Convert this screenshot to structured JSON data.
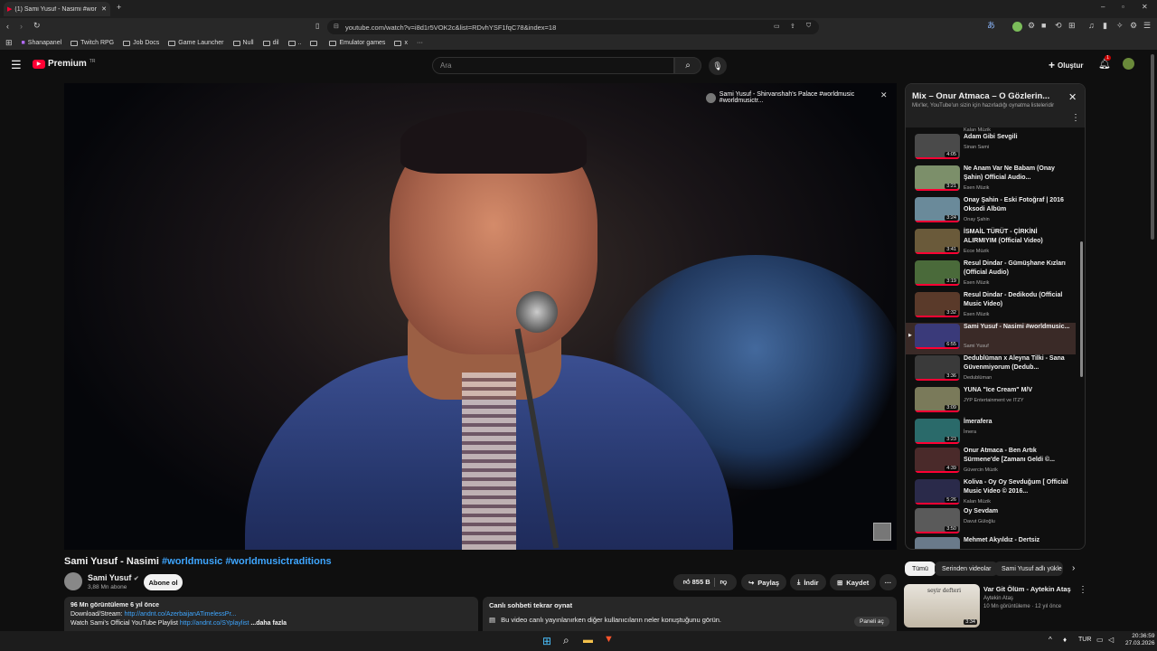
{
  "browser": {
    "tab_title": "(1) Sami Yusuf - Nasimi #wor",
    "url": "youtube.com/watch?v=i8d1r5VOK2c&list=RDvhYSF1fqC78&index=18",
    "bookmarks": [
      "Shanapanel",
      "Twitch RPG",
      "Job Docs",
      "Game Launcher",
      "Null",
      "dil",
      "..",
      "",
      "Emulator games",
      "x"
    ]
  },
  "header": {
    "logo": "Premium",
    "logo_sup": "TR",
    "search_placeholder": "Ara",
    "create_label": "Oluştur",
    "notif_count": "1"
  },
  "video": {
    "overlay_title": "Sami Yusuf - Shirvanshah's Palace #worldmusic #worldmusictr...",
    "title_main": "Sami Yusuf - Nasimi ",
    "title_tags": "#worldmusic #worldmusictraditions"
  },
  "channel": {
    "name": "Sami Yusuf",
    "subs": "3,88 Mn abone",
    "subscribe": "Abone ol"
  },
  "actions": {
    "likes": "855 B",
    "share": "Paylaş",
    "download": "İndir",
    "save": "Kaydet"
  },
  "description": {
    "line1": "96 Mn görüntüleme  6 yıl önce",
    "line2_prefix": "Download/Stream: ",
    "line2_link": "http://andnt.co/AzerbaijanATimelessPr...",
    "line3_prefix": "Watch Sami's Official YouTube Playlist ",
    "line3_link": "http://andnt.co/SYplaylist",
    "more": " ...daha fazla"
  },
  "chat": {
    "title": "Canlı sohbeti tekrar oynat",
    "text": "Bu video canlı yayınlanırken diğer kullanıcıların neler konuştuğunu görün.",
    "button": "Paneli aç"
  },
  "playlist": {
    "title": "Mix – Onur Atmaca – O Gözlerin...",
    "subtitle": "Mix'ler, YouTube'un sizin için hazırladığı oynatma listeleridir",
    "top_channel": "Kalan Müzik",
    "items": [
      {
        "title": "Adam Gibi Sevgili",
        "channel": "Sinan Sami",
        "dur": "4:05",
        "color": "#4a4a4a"
      },
      {
        "title": "Ne Anam Var Ne Babam (Onay Şahin) Official Audio...",
        "channel": "Esen Müzik",
        "dur": "3:21",
        "color": "#7c8f6a"
      },
      {
        "title": "Onay Şahin - Eski Fotoğraf | 2016 Oksodi Albüm",
        "channel": "Onay Şahin",
        "dur": "3:24",
        "color": "#6a8a9a"
      },
      {
        "title": "İSMAİL TÜRÜT - ÇİRKİNİ ALIRMIYIM (Official Video)",
        "channel": "Ecce Müzik",
        "dur": "3:41",
        "color": "#6a5a3a"
      },
      {
        "title": "Resul Dindar - Gümüşhane Kızları (Official Audio)",
        "channel": "Esen Müzik",
        "dur": "3:19",
        "color": "#4a6a3a"
      },
      {
        "title": "Resul Dindar - Dedikodu (Official Music Video)",
        "channel": "Esen Müzik",
        "dur": "3:32",
        "color": "#5a3a2a"
      },
      {
        "title": "Sami Yusuf - Nasimi #worldmusic...",
        "channel": "Sami Yusuf",
        "dur": "6:55",
        "color": "#3a3a7a",
        "active": true
      },
      {
        "title": "Dedublüman x Aleyna Tilki - Sana Güvenmiyorum (Dedub...",
        "channel": "Dedublüman",
        "dur": "3:36",
        "color": "#3a3a3a"
      },
      {
        "title": "YUNA \"Ice Cream\" M/V",
        "channel": "JYP Entertainment ve ITZY",
        "dur": "3:09",
        "color": "#7a7a5a"
      },
      {
        "title": "İmerafera",
        "channel": "İmera",
        "dur": "3:23",
        "color": "#2a6a6a"
      },
      {
        "title": "Onur Atmaca - Ben Artık Sürmene'de [Zamanı Geldi ©...",
        "channel": "Güvercin Müzik",
        "dur": "4:39",
        "color": "#4a2a2a"
      },
      {
        "title": "Koliva - Oy Oy Sevduğum [ Official Music Video © 2016...",
        "channel": "Kalan Müzik",
        "dur": "5:26",
        "color": "#2a2a4a"
      },
      {
        "title": "Oy Sevdam",
        "channel": "Davut Güloğlu",
        "dur": "3:50",
        "color": "#5a5a5a"
      },
      {
        "title": "Mehmet Akyıldız - Dertsiz",
        "channel": "",
        "dur": "",
        "color": "#6a7a8a"
      }
    ]
  },
  "chips": [
    "Tümü",
    "Serinden videolar",
    "Sami Yusuf adlı yükle"
  ],
  "recommended": {
    "title": "Var Git Ölüm - Aytekin Ataş",
    "channel": "Aytekin Ataş",
    "meta": "10 Mn görüntüleme · 12 yıl önce",
    "dur": "3:34",
    "thumb_text": "seyir defteri"
  },
  "taskbar": {
    "lang": "TUR",
    "time": "20:36:59",
    "date": "27.03.2026"
  },
  "colors": {
    "accent": "#3ea6ff",
    "youtube_red": "#ff0033"
  }
}
